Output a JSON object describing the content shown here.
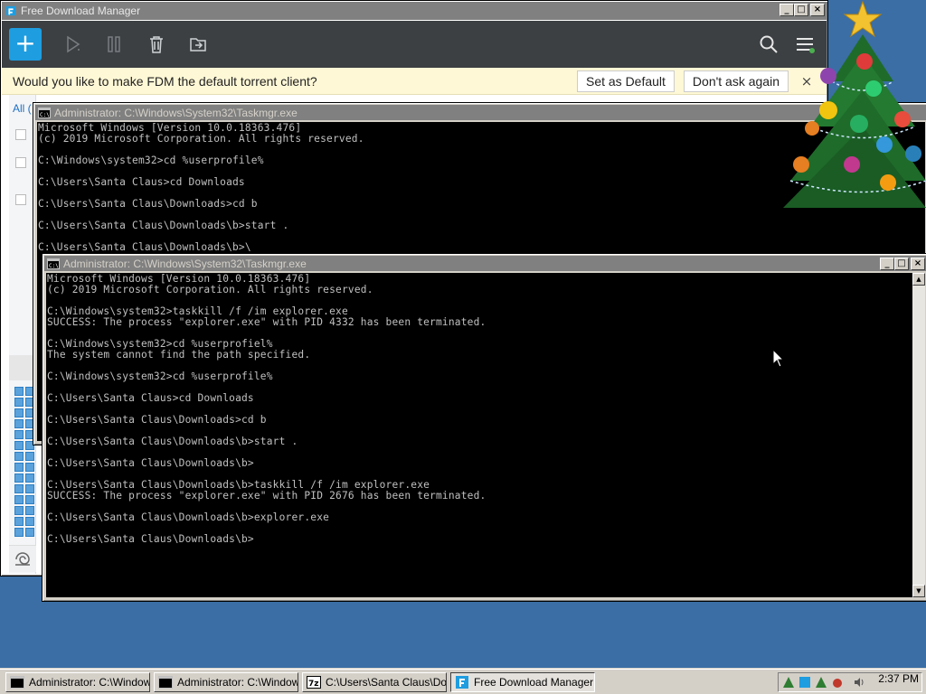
{
  "fdm": {
    "title": "Free Download Manager",
    "notice": "Would you like to make FDM the default torrent client?",
    "set_default": "Set as Default",
    "dont_ask": "Don't ask again",
    "close_symbol": "×",
    "tab_all": "All (",
    "add_symbol": "+"
  },
  "cmd1": {
    "title": "Administrator: C:\\Windows\\System32\\Taskmgr.exe",
    "lines": [
      "Microsoft Windows [Version 10.0.18363.476]",
      "(c) 2019 Microsoft Corporation. All rights reserved.",
      "",
      "C:\\Windows\\system32>cd %userprofile%",
      "",
      "C:\\Users\\Santa Claus>cd Downloads",
      "",
      "C:\\Users\\Santa Claus\\Downloads>cd b",
      "",
      "C:\\Users\\Santa Claus\\Downloads\\b>start .",
      "",
      "C:\\Users\\Santa Claus\\Downloads\\b>\\"
    ]
  },
  "cmd2": {
    "title": "Administrator: C:\\Windows\\System32\\Taskmgr.exe",
    "lines": [
      "Microsoft Windows [Version 10.0.18363.476]",
      "(c) 2019 Microsoft Corporation. All rights reserved.",
      "",
      "C:\\Windows\\system32>taskkill /f /im explorer.exe",
      "SUCCESS: The process \"explorer.exe\" with PID 4332 has been terminated.",
      "",
      "C:\\Windows\\system32>cd %userprofiel%",
      "The system cannot find the path specified.",
      "",
      "C:\\Windows\\system32>cd %userprofile%",
      "",
      "C:\\Users\\Santa Claus>cd Downloads",
      "",
      "C:\\Users\\Santa Claus\\Downloads>cd b",
      "",
      "C:\\Users\\Santa Claus\\Downloads\\b>start .",
      "",
      "C:\\Users\\Santa Claus\\Downloads\\b>",
      "",
      "C:\\Users\\Santa Claus\\Downloads\\b>taskkill /f /im explorer.exe",
      "SUCCESS: The process \"explorer.exe\" with PID 2676 has been terminated.",
      "",
      "C:\\Users\\Santa Claus\\Downloads\\b>explorer.exe",
      "",
      "C:\\Users\\Santa Claus\\Downloads\\b>"
    ]
  },
  "window_buttons": {
    "minimize": "_",
    "maximize": "□",
    "close": "×"
  },
  "taskbar": {
    "tasks": [
      {
        "label": "Administrator: C:\\Window...",
        "icon": "console-icon"
      },
      {
        "label": "Administrator: C:\\Window...",
        "icon": "console-icon"
      },
      {
        "label": "C:\\Users\\Santa Claus\\Do...",
        "icon": "7zip-icon"
      },
      {
        "label": "Free Download Manager",
        "icon": "fdm-icon"
      }
    ],
    "clock": "2:37 PM"
  },
  "colors": {
    "desktop": "#3a6ea5",
    "fdm_accent": "#1e9de0",
    "fdm_toolbar": "#3c4043",
    "console_bg": "#000000",
    "console_text": "#c0c0c0"
  }
}
